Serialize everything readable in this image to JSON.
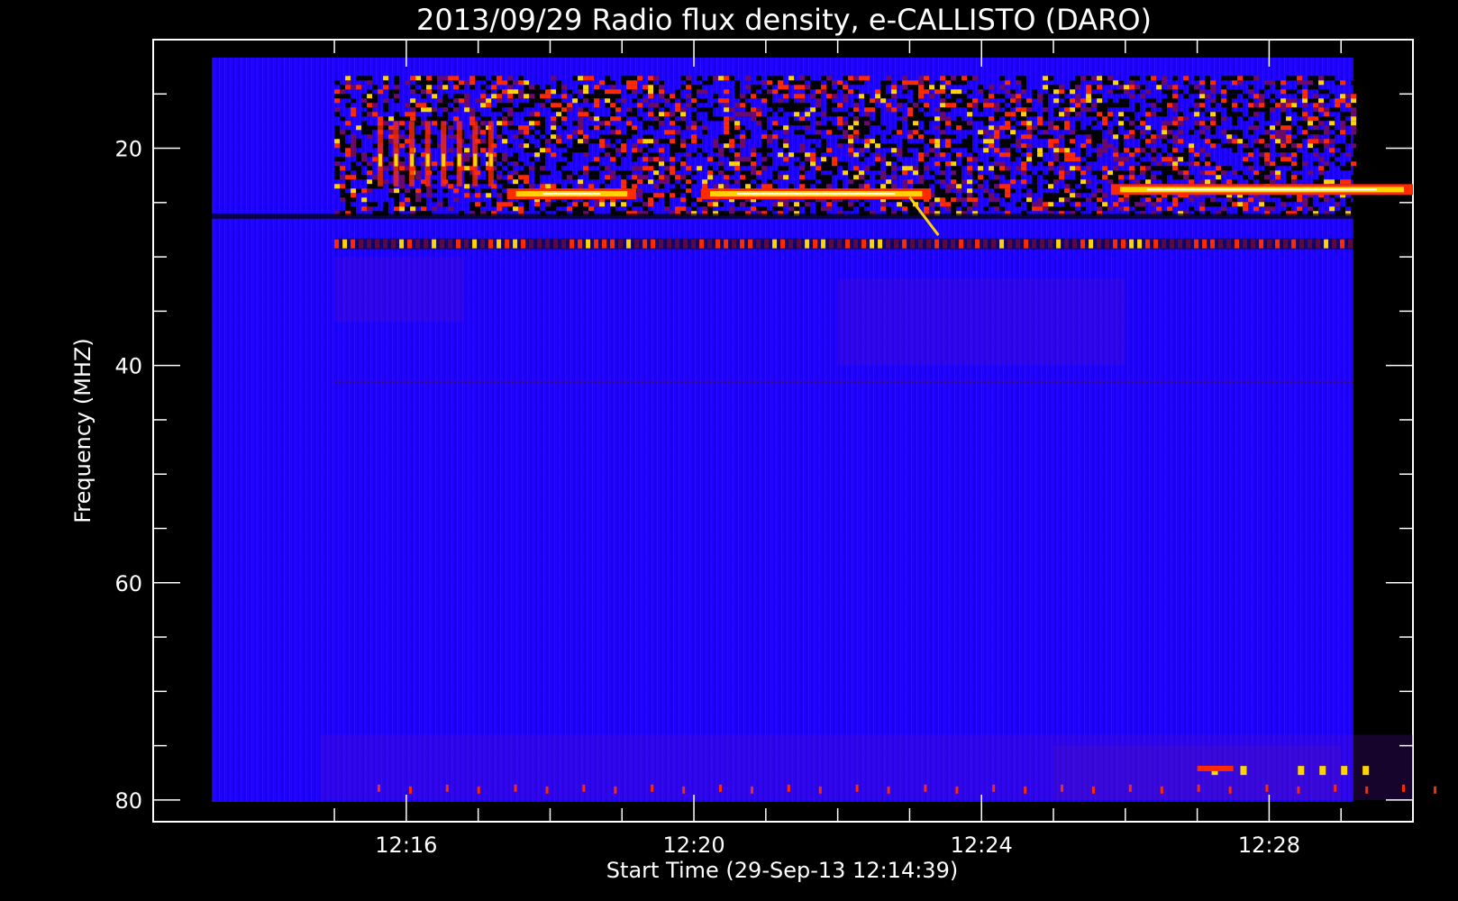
{
  "chart_data": {
    "type": "heatmap",
    "title": "2013/09/29  Radio flux density, e-CALLISTO (DARO)",
    "xlabel": "Start Time (29-Sep-13 12:14:39)",
    "ylabel": "Frequency (MHZ)",
    "x_ticks": [
      "12:16",
      "12:20",
      "12:24",
      "12:28"
    ],
    "y_ticks": [
      "20",
      "40",
      "60",
      "80"
    ],
    "xlim_minutes": [
      12.48,
      30.0
    ],
    "ylim_mhz": [
      10.0,
      82.0
    ],
    "colormap": [
      "#000000",
      "#1e00ff",
      "#ff2a00",
      "#ffd400",
      "#ffffff"
    ],
    "background_color": "#1e00ff",
    "features": [
      {
        "kind": "interference_band",
        "freq_range_mhz": [
          15,
          26
        ],
        "time_range_min": [
          15.0,
          30.0
        ],
        "intensity": "high"
      },
      {
        "kind": "bright_line",
        "freq_mhz": 24.2,
        "time_range_min": [
          17.4,
          19.2
        ]
      },
      {
        "kind": "bright_line",
        "freq_mhz": 24.2,
        "time_range_min": [
          20.1,
          23.3
        ]
      },
      {
        "kind": "bright_line",
        "freq_mhz": 23.8,
        "time_range_min": [
          25.8,
          30.0
        ]
      },
      {
        "kind": "dotted_line",
        "freq_mhz": 28.8,
        "time_range_min": [
          15.0,
          30.0
        ]
      },
      {
        "kind": "dotted_line",
        "freq_mhz": 41.5,
        "time_range_min": [
          15.0,
          30.0
        ]
      },
      {
        "kind": "dotted_line",
        "freq_mhz": 79.0,
        "time_range_min": [
          15.0,
          30.0
        ]
      },
      {
        "kind": "drift_streak",
        "freq_range_mhz": [
          24.5,
          28.0
        ],
        "time_range_min": [
          23.0,
          23.4
        ]
      }
    ]
  }
}
